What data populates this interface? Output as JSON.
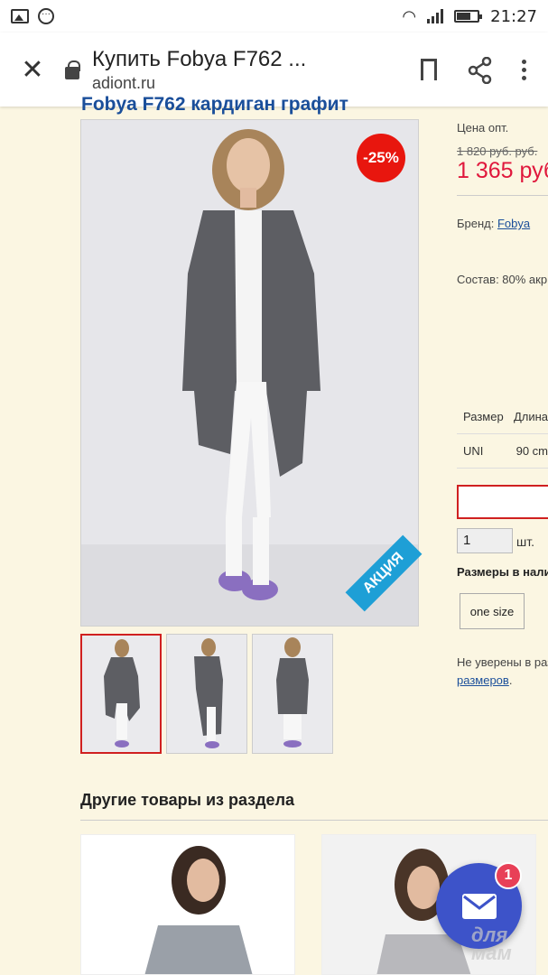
{
  "status_bar": {
    "time": "21:27",
    "left_icons": [
      "image-icon",
      "notification-dots-icon"
    ],
    "right_icons": [
      "wifi-icon",
      "signal-icon",
      "battery-icon"
    ]
  },
  "browser": {
    "page_title": "Купить Fobya F762 ...",
    "url": "adiont.ru",
    "icons": [
      "close-icon",
      "lock-icon",
      "bookmark-icon",
      "share-icon",
      "overflow-menu-icon"
    ]
  },
  "product": {
    "heading": "Fobya F762 кардиган графит",
    "discount_badge": "-25%",
    "promo_ribbon": "АКЦИЯ",
    "price_label": "Цена опт.",
    "old_price": "1 820 руб. руб.",
    "new_price": "1 365 руб",
    "brand_label": "Бренд: ",
    "brand_link": "Fobya",
    "composition": "Состав: 80% акр",
    "size_table": {
      "headers": [
        "Размер",
        "Длина"
      ],
      "rows": [
        [
          "UNI",
          "90 cm"
        ]
      ]
    },
    "quantity": "1",
    "quantity_unit": "шт.",
    "sizes_available_label": "Размеры в нали",
    "size_option": "one size",
    "unsure_text": "Не уверены в раз",
    "size_guide_link": "размеров",
    "size_guide_suffix": "."
  },
  "thumbnails": [
    "thumb-front",
    "thumb-side",
    "thumb-back"
  ],
  "related": {
    "section_title": "Другие товары из раздела"
  },
  "chat_fab": {
    "badge": "1",
    "watermark": "для мам"
  },
  "colors": {
    "accent_blue": "#1a4e9a",
    "price_red": "#e0183c",
    "discount_red": "#e8160e",
    "fab_blue": "#3d53c9",
    "page_bg": "#fbf6e2"
  }
}
